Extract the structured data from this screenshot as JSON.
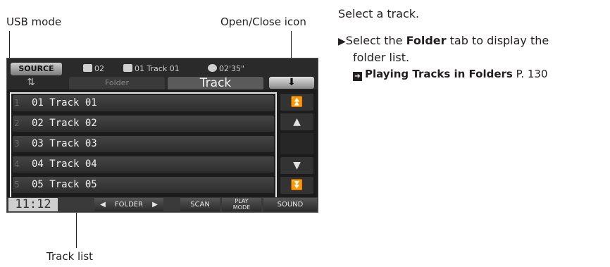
{
  "callouts": {
    "usb_mode": "USB mode",
    "open_close_icon": "Open/Close icon",
    "track_list": "Track list"
  },
  "screen": {
    "source_label": "SOURCE",
    "folder_num": "02",
    "track_info": "01 Track 01",
    "time": "02'35\"",
    "tabs": {
      "folder": "Folder",
      "track": "Track"
    },
    "tracks": [
      {
        "index": "1",
        "title": "01 Track 01"
      },
      {
        "index": "2",
        "title": "02 Track 02"
      },
      {
        "index": "3",
        "title": "03 Track 03"
      },
      {
        "index": "4",
        "title": "04 Track 04"
      },
      {
        "index": "5",
        "title": "05 Track 05"
      }
    ],
    "clock": "11:12",
    "bottom": {
      "folder": "FOLDER",
      "scan": "SCAN",
      "play_mode_1": "PLAY",
      "play_mode_2": "MODE",
      "sound": "SOUND"
    },
    "icons": {
      "usb": "usb-icon",
      "open_close": "open-close-icon",
      "scroll_top": "double-up-arrow-icon",
      "scroll_up": "up-arrow-icon",
      "scroll_down": "down-arrow-icon",
      "scroll_bottom": "double-down-arrow-icon"
    }
  },
  "instructions": {
    "step": "Select a track.",
    "sub_prefix": "Select the ",
    "sub_bold": "Folder",
    "sub_suffix": " tab to display the",
    "sub_line2": "folder list.",
    "ref_title": "Playing Tracks in Folders",
    "ref_page": " P. 130"
  }
}
